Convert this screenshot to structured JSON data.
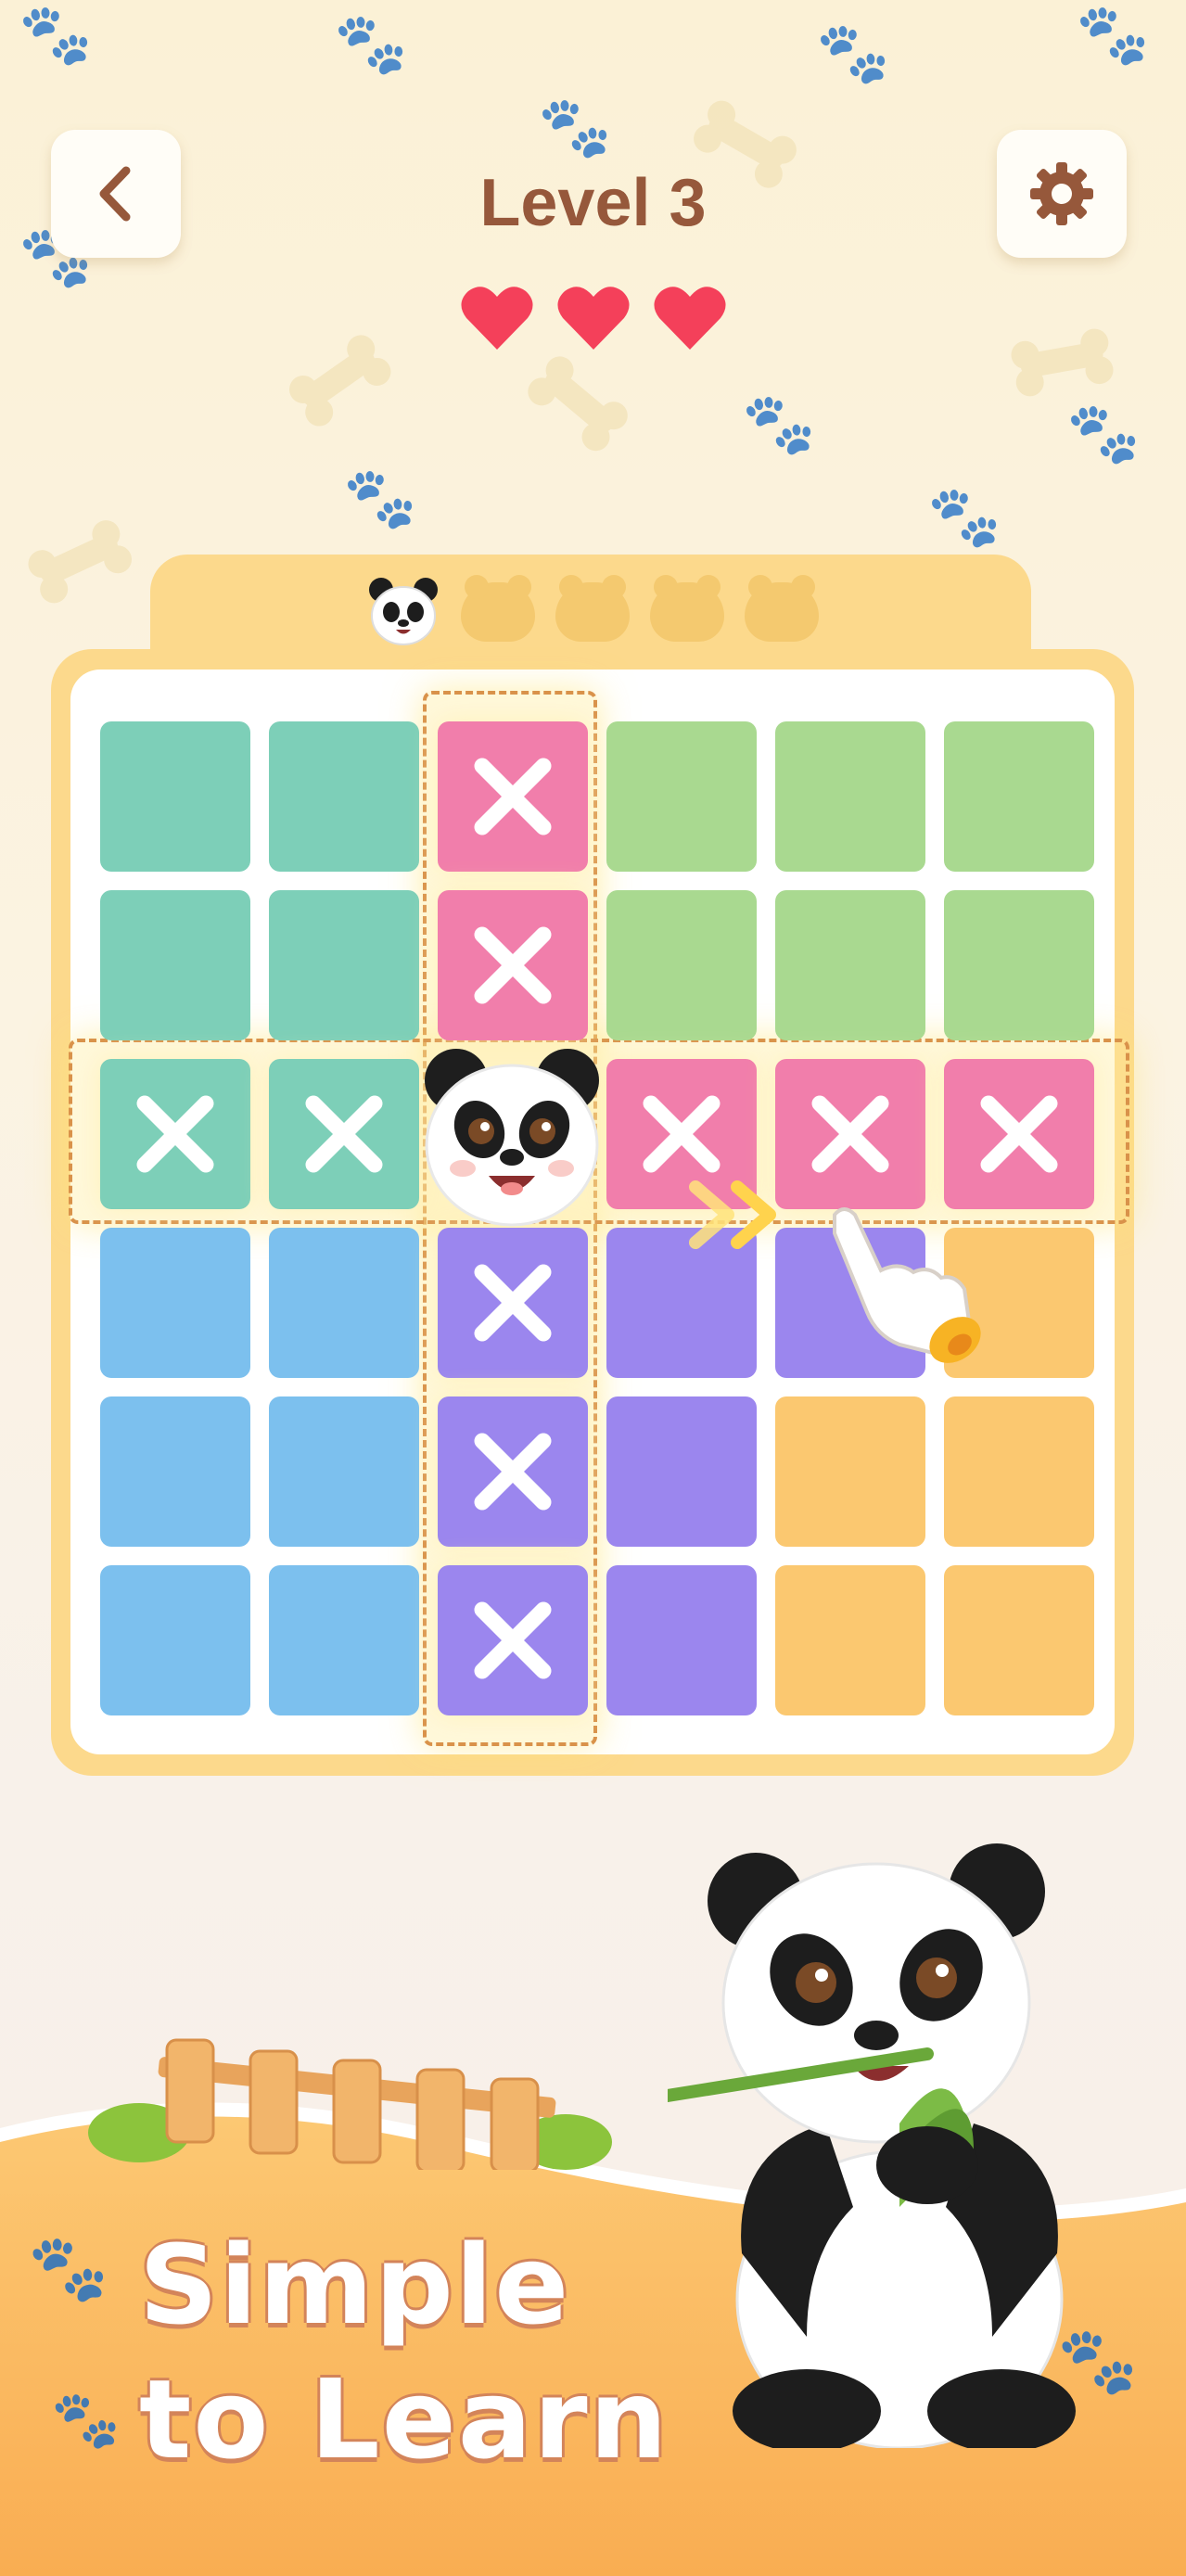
{
  "header": {
    "title": "Level 3",
    "lives": 3,
    "lives_max": 3,
    "back_icon": "chevron-left-icon",
    "settings_icon": "gear-icon"
  },
  "progress": {
    "collected": 1,
    "total": 5
  },
  "board": {
    "rows": 6,
    "cols": 6,
    "panda_cell": [
      2,
      2
    ],
    "cells": [
      [
        "teal",
        "teal",
        "pink-x",
        "green",
        "green",
        "green"
      ],
      [
        "teal",
        "teal",
        "pink-x",
        "green",
        "green",
        "green"
      ],
      [
        "teal-x",
        "teal-x",
        "panda",
        "pink-x",
        "pink-x",
        "pink-x"
      ],
      [
        "blue",
        "blue",
        "purple-x",
        "purple",
        "purple",
        "orange"
      ],
      [
        "blue",
        "blue",
        "purple-x",
        "purple",
        "orange",
        "orange"
      ],
      [
        "blue",
        "blue",
        "purple-x",
        "purple",
        "orange",
        "orange"
      ]
    ],
    "colors": {
      "teal": "#7dcfb8",
      "green": "#a9d990",
      "pink": "#f17eab",
      "blue": "#7cc0ee",
      "purple": "#9b86ee",
      "orange": "#fbc870"
    }
  },
  "tutorial": {
    "gesture": "swipe-right",
    "hand_icon": "pointing-hand-icon"
  },
  "banner": {
    "line1": "Simple",
    "line2": "to Learn"
  },
  "colors": {
    "title": "#96583b",
    "heart": "#f4405a",
    "frame": "#fcd98c",
    "banner": "#fbb65a"
  }
}
